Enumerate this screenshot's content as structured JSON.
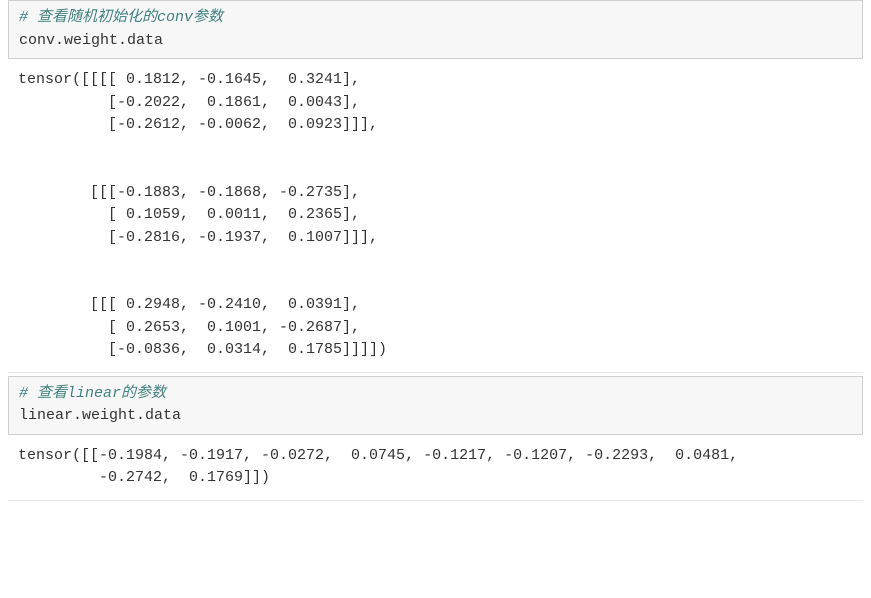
{
  "cells": [
    {
      "input": {
        "comment": "# 查看随机初始化的conv参数",
        "code": "conv.weight.data"
      },
      "output": "tensor([[[[ 0.1812, -0.1645,  0.3241],\n          [-0.2022,  0.1861,  0.0043],\n          [-0.2612, -0.0062,  0.0923]]],\n\n\n        [[[-0.1883, -0.1868, -0.2735],\n          [ 0.1059,  0.0011,  0.2365],\n          [-0.2816, -0.1937,  0.1007]]],\n\n\n        [[[ 0.2948, -0.2410,  0.0391],\n          [ 0.2653,  0.1001, -0.2687],\n          [-0.0836,  0.0314,  0.1785]]]])"
    },
    {
      "input": {
        "comment": "# 查看linear的参数",
        "code": "linear.weight.data"
      },
      "output": "tensor([[-0.1984, -0.1917, -0.0272,  0.0745, -0.1217, -0.1207, -0.2293,  0.0481,\n         -0.2742,  0.1769]])"
    }
  ]
}
